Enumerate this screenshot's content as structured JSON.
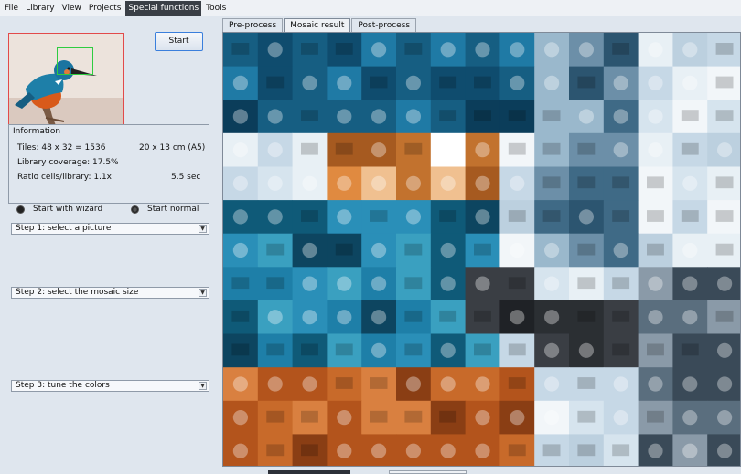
{
  "menu": {
    "items": [
      {
        "label": "File",
        "active": false
      },
      {
        "label": "Library",
        "active": false
      },
      {
        "label": "View",
        "active": false
      },
      {
        "label": "Projects",
        "active": false
      },
      {
        "label": "Special functions",
        "active": true
      },
      {
        "label": "Tools",
        "active": false
      }
    ]
  },
  "controls": {
    "start_label": "Start"
  },
  "information": {
    "title": "Information",
    "tiles": "Tiles: 48 x 32 = 1536",
    "size": "20 x 13 cm  (A5)",
    "coverage": "Library coverage: 17.5%",
    "ratio": "Ratio cells/library: 1.1x",
    "time": "5.5 sec"
  },
  "modes": {
    "wizard_label": "Start with wizard",
    "normal_label": "Start normal",
    "selected": "wizard"
  },
  "steps": [
    {
      "label": "Step 1: select a picture"
    },
    {
      "label": "Step 2: select the mosaic size"
    },
    {
      "label": "Step 3: tune the colors"
    }
  ],
  "tabs": [
    {
      "label": "Pre-process",
      "active": false
    },
    {
      "label": "Mosaic result",
      "active": true
    },
    {
      "label": "Post-process",
      "active": false
    }
  ],
  "colors": {
    "accent_blue": "#3a7fdc",
    "thumb_border": "#e24a4a",
    "selection_green": "#2ecc40",
    "active_menu_bg": "#3a3f46"
  },
  "icons": {
    "thumbnail": "kingfisher-thumbnail-image",
    "mosaic": "kingfisher-mosaic-image",
    "dropdown": "chevron-down-icon"
  }
}
